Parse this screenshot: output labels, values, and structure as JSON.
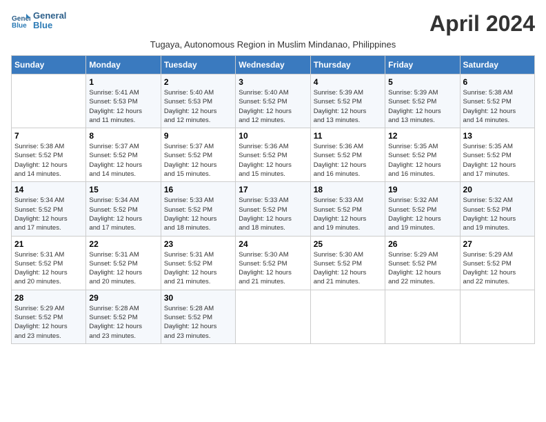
{
  "header": {
    "logo_line1": "General",
    "logo_line2": "Blue",
    "month_title": "April 2024",
    "subtitle": "Tugaya, Autonomous Region in Muslim Mindanao, Philippines"
  },
  "days_of_week": [
    "Sunday",
    "Monday",
    "Tuesday",
    "Wednesday",
    "Thursday",
    "Friday",
    "Saturday"
  ],
  "weeks": [
    [
      {
        "day": "",
        "info": ""
      },
      {
        "day": "1",
        "info": "Sunrise: 5:41 AM\nSunset: 5:53 PM\nDaylight: 12 hours\nand 11 minutes."
      },
      {
        "day": "2",
        "info": "Sunrise: 5:40 AM\nSunset: 5:53 PM\nDaylight: 12 hours\nand 12 minutes."
      },
      {
        "day": "3",
        "info": "Sunrise: 5:40 AM\nSunset: 5:52 PM\nDaylight: 12 hours\nand 12 minutes."
      },
      {
        "day": "4",
        "info": "Sunrise: 5:39 AM\nSunset: 5:52 PM\nDaylight: 12 hours\nand 13 minutes."
      },
      {
        "day": "5",
        "info": "Sunrise: 5:39 AM\nSunset: 5:52 PM\nDaylight: 12 hours\nand 13 minutes."
      },
      {
        "day": "6",
        "info": "Sunrise: 5:38 AM\nSunset: 5:52 PM\nDaylight: 12 hours\nand 14 minutes."
      }
    ],
    [
      {
        "day": "7",
        "info": "Sunrise: 5:38 AM\nSunset: 5:52 PM\nDaylight: 12 hours\nand 14 minutes."
      },
      {
        "day": "8",
        "info": "Sunrise: 5:37 AM\nSunset: 5:52 PM\nDaylight: 12 hours\nand 14 minutes."
      },
      {
        "day": "9",
        "info": "Sunrise: 5:37 AM\nSunset: 5:52 PM\nDaylight: 12 hours\nand 15 minutes."
      },
      {
        "day": "10",
        "info": "Sunrise: 5:36 AM\nSunset: 5:52 PM\nDaylight: 12 hours\nand 15 minutes."
      },
      {
        "day": "11",
        "info": "Sunrise: 5:36 AM\nSunset: 5:52 PM\nDaylight: 12 hours\nand 16 minutes."
      },
      {
        "day": "12",
        "info": "Sunrise: 5:35 AM\nSunset: 5:52 PM\nDaylight: 12 hours\nand 16 minutes."
      },
      {
        "day": "13",
        "info": "Sunrise: 5:35 AM\nSunset: 5:52 PM\nDaylight: 12 hours\nand 17 minutes."
      }
    ],
    [
      {
        "day": "14",
        "info": "Sunrise: 5:34 AM\nSunset: 5:52 PM\nDaylight: 12 hours\nand 17 minutes."
      },
      {
        "day": "15",
        "info": "Sunrise: 5:34 AM\nSunset: 5:52 PM\nDaylight: 12 hours\nand 17 minutes."
      },
      {
        "day": "16",
        "info": "Sunrise: 5:33 AM\nSunset: 5:52 PM\nDaylight: 12 hours\nand 18 minutes."
      },
      {
        "day": "17",
        "info": "Sunrise: 5:33 AM\nSunset: 5:52 PM\nDaylight: 12 hours\nand 18 minutes."
      },
      {
        "day": "18",
        "info": "Sunrise: 5:33 AM\nSunset: 5:52 PM\nDaylight: 12 hours\nand 19 minutes."
      },
      {
        "day": "19",
        "info": "Sunrise: 5:32 AM\nSunset: 5:52 PM\nDaylight: 12 hours\nand 19 minutes."
      },
      {
        "day": "20",
        "info": "Sunrise: 5:32 AM\nSunset: 5:52 PM\nDaylight: 12 hours\nand 19 minutes."
      }
    ],
    [
      {
        "day": "21",
        "info": "Sunrise: 5:31 AM\nSunset: 5:52 PM\nDaylight: 12 hours\nand 20 minutes."
      },
      {
        "day": "22",
        "info": "Sunrise: 5:31 AM\nSunset: 5:52 PM\nDaylight: 12 hours\nand 20 minutes."
      },
      {
        "day": "23",
        "info": "Sunrise: 5:31 AM\nSunset: 5:52 PM\nDaylight: 12 hours\nand 21 minutes."
      },
      {
        "day": "24",
        "info": "Sunrise: 5:30 AM\nSunset: 5:52 PM\nDaylight: 12 hours\nand 21 minutes."
      },
      {
        "day": "25",
        "info": "Sunrise: 5:30 AM\nSunset: 5:52 PM\nDaylight: 12 hours\nand 21 minutes."
      },
      {
        "day": "26",
        "info": "Sunrise: 5:29 AM\nSunset: 5:52 PM\nDaylight: 12 hours\nand 22 minutes."
      },
      {
        "day": "27",
        "info": "Sunrise: 5:29 AM\nSunset: 5:52 PM\nDaylight: 12 hours\nand 22 minutes."
      }
    ],
    [
      {
        "day": "28",
        "info": "Sunrise: 5:29 AM\nSunset: 5:52 PM\nDaylight: 12 hours\nand 23 minutes."
      },
      {
        "day": "29",
        "info": "Sunrise: 5:28 AM\nSunset: 5:52 PM\nDaylight: 12 hours\nand 23 minutes."
      },
      {
        "day": "30",
        "info": "Sunrise: 5:28 AM\nSunset: 5:52 PM\nDaylight: 12 hours\nand 23 minutes."
      },
      {
        "day": "",
        "info": ""
      },
      {
        "day": "",
        "info": ""
      },
      {
        "day": "",
        "info": ""
      },
      {
        "day": "",
        "info": ""
      }
    ]
  ]
}
